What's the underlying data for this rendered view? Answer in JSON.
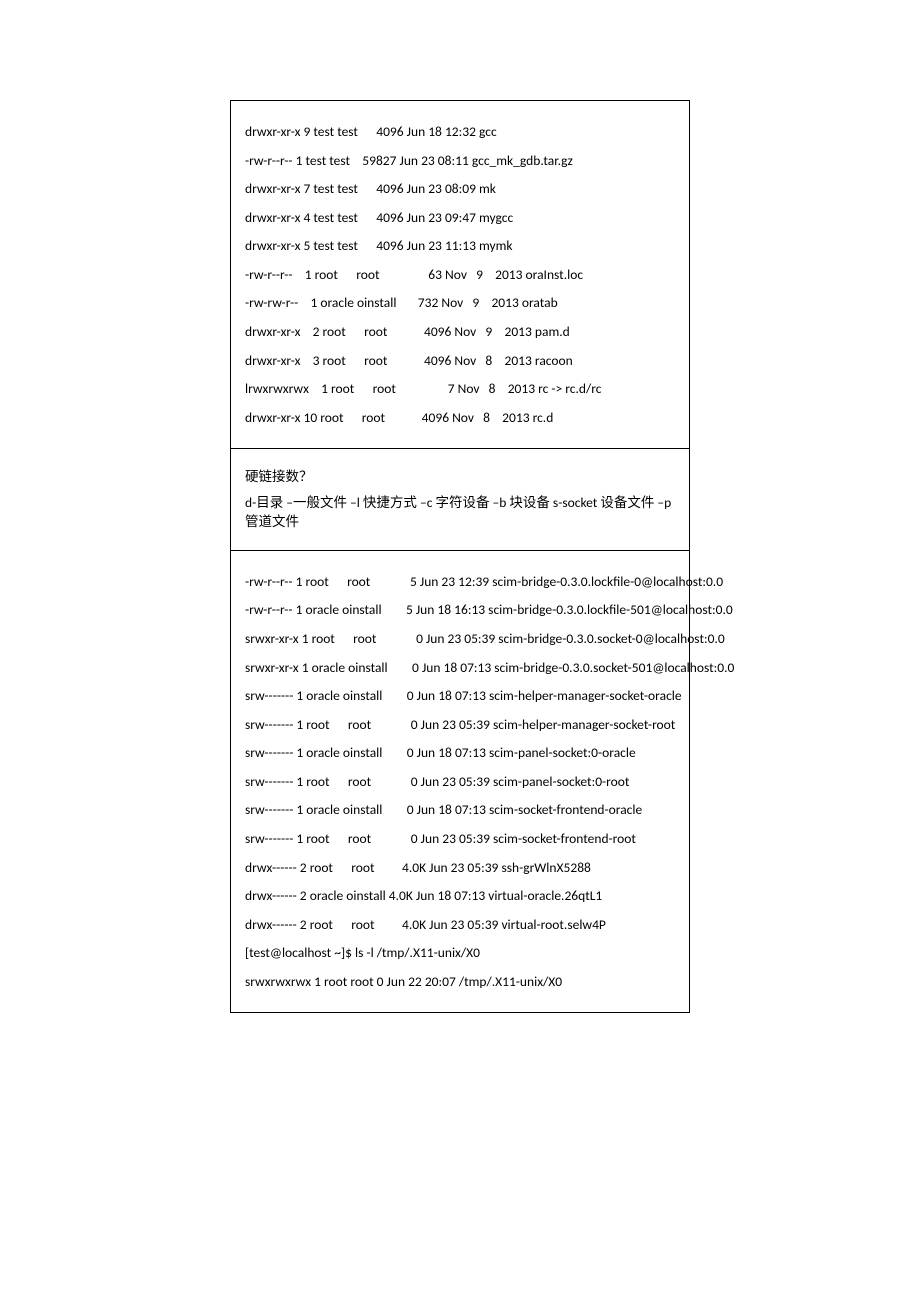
{
  "c1": {
    "l0": "drwxr-xr-x 9 test test      4096 Jun 18 12:32 gcc",
    "l1": "-rw-r--r-- 1 test test    59827 Jun 23 08:11 gcc_mk_gdb.tar.gz",
    "l2": "drwxr-xr-x 7 test test      4096 Jun 23 08:09 mk",
    "l3": "drwxr-xr-x 4 test test      4096 Jun 23 09:47 mygcc",
    "l4": "drwxr-xr-x 5 test test      4096 Jun 23 11:13 mymk",
    "l5": "-rw-r--r--    1 root      root                63 Nov   9    2013 oraInst.loc",
    "l6": "-rw-rw-r--    1 oracle oinstall       732 Nov   9    2013 oratab",
    "l7": "drwxr-xr-x    2 root      root            4096 Nov   9    2013 pam.d",
    "l8": "drwxr-xr-x    3 root      root            4096 Nov   8    2013 racoon",
    "l9": "lrwxrwxrwx    1 root      root                 7 Nov   8    2013 rc -> rc.d/rc",
    "l10": "drwxr-xr-x 10 root      root            4096 Nov   8    2013 rc.d"
  },
  "c2": {
    "l0": "硬链接数？",
    "l1": "d-目录  –一般文件  –l 快捷方式  –c 字符设备  –b 块设备  s-socket 设备文件  –p 管道文件"
  },
  "c3": {
    "l0": "-rw-r--r-- 1 root      root             5 Jun 23 12:39 scim-bridge-0.3.0.lockfile-0@localhost:0.0",
    "l1": "-rw-r--r-- 1 oracle oinstall        5 Jun 18 16:13 scim-bridge-0.3.0.lockfile-501@localhost:0.0",
    "l2": "srwxr-xr-x 1 root      root             0 Jun 23 05:39 scim-bridge-0.3.0.socket-0@localhost:0.0",
    "l3": "srwxr-xr-x 1 oracle oinstall        0 Jun 18 07:13 scim-bridge-0.3.0.socket-501@localhost:0.0",
    "l4": "srw------- 1 oracle oinstall        0 Jun 18 07:13 scim-helper-manager-socket-oracle",
    "l5": "srw------- 1 root      root             0 Jun 23 05:39 scim-helper-manager-socket-root",
    "l6": "srw------- 1 oracle oinstall        0 Jun 18 07:13 scim-panel-socket:0-oracle",
    "l7": "srw------- 1 root      root             0 Jun 23 05:39 scim-panel-socket:0-root",
    "l8": "srw------- 1 oracle oinstall        0 Jun 18 07:13 scim-socket-frontend-oracle",
    "l9": "srw------- 1 root      root             0 Jun 23 05:39 scim-socket-frontend-root",
    "l10": "drwx------ 2 root      root         4.0K Jun 23 05:39 ssh-grWlnX5288",
    "l11": "drwx------ 2 oracle oinstall 4.0K Jun 18 07:13 virtual-oracle.26qtL1",
    "l12": "drwx------ 2 root      root         4.0K Jun 23 05:39 virtual-root.selw4P",
    "l13": "[test@localhost ~]$ ls -l /tmp/.X11-unix/X0",
    "l14": "srwxrwxrwx 1 root root 0 Jun 22 20:07 /tmp/.X11-unix/X0"
  }
}
